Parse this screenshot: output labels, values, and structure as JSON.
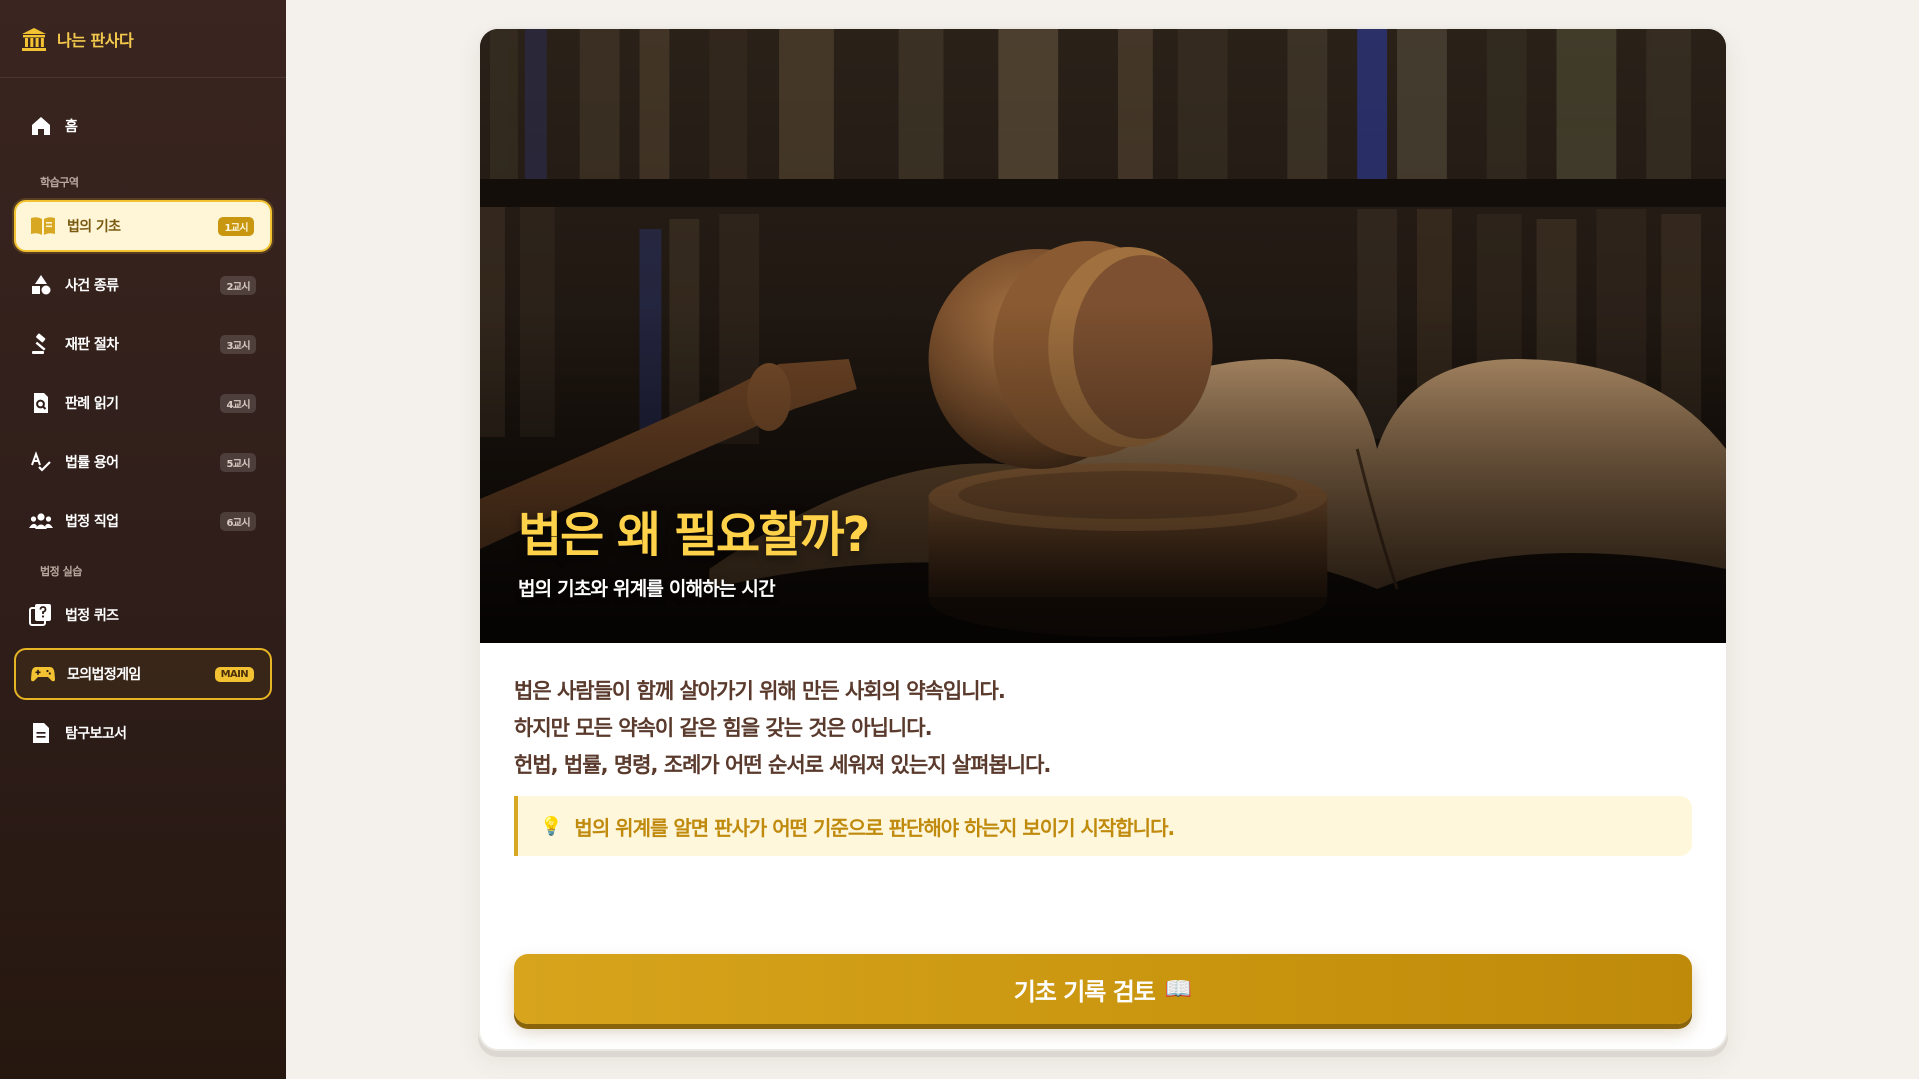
{
  "app": {
    "brand": "나는 판사다"
  },
  "sidebar": {
    "home": {
      "label": "홈"
    },
    "sections": [
      {
        "label": "학습구역"
      },
      {
        "label": "법정 실습"
      }
    ],
    "learn_items": [
      {
        "label": "법의 기초",
        "badge": "1교시",
        "icon": "book-open-icon",
        "active": true
      },
      {
        "label": "사건 종류",
        "badge": "2교시",
        "icon": "shapes-icon"
      },
      {
        "label": "재판 절차",
        "badge": "3교시",
        "icon": "gavel-icon"
      },
      {
        "label": "판례 읽기",
        "badge": "4교시",
        "icon": "document-search-icon"
      },
      {
        "label": "법률 용어",
        "badge": "5교시",
        "icon": "spellcheck-icon"
      },
      {
        "label": "법정 직업",
        "badge": "6교시",
        "icon": "people-icon"
      }
    ],
    "practice_items": [
      {
        "label": "법정 퀴즈",
        "icon": "quiz-icon"
      },
      {
        "label": "모의법정게임",
        "badge": "MAIN",
        "icon": "gamepad-icon"
      },
      {
        "label": "탐구보고서",
        "icon": "report-icon"
      }
    ]
  },
  "lesson": {
    "title": "법은 왜 필요할까?",
    "subtitle": "법의 기초와 위계를 이해하는 시간",
    "paragraphs": [
      "법은 사람들이 함께 살아가기 위해 만든 사회의 약속입니다.",
      "하지만 모든 약속이 같은 힘을 갖는 것은 아닙니다.",
      "헌법, 법률, 명령, 조례가 어떤 순서로 세워져 있는지 살펴봅니다."
    ],
    "tip": {
      "icon": "💡",
      "text": "법의 위계를 알면 판사가 어떤 기준으로 판단해야 하는지 보이기 시작합니다."
    },
    "cta": {
      "label": "기초 기록 검토",
      "emoji": "📖"
    }
  },
  "colors": {
    "accent": "#f2c232",
    "sidebar_bg": "#2e1d19",
    "title_yellow": "#ffd24a",
    "tip_text": "#c08a0d",
    "cta": "#c9950f"
  }
}
